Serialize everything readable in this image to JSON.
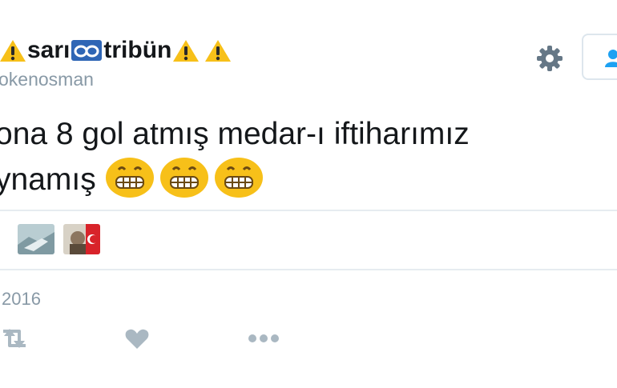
{
  "tweet": {
    "author": {
      "name_parts": [
        "sarı",
        "tribün"
      ],
      "username": "okenosman"
    },
    "text_lines": [
      "ona 8 gol atmış medar-ı iftiharımız",
      "ynamış"
    ],
    "date": "2016"
  },
  "icons": {
    "name_emojis": [
      "warning-sign",
      "loop",
      "warning-sign",
      "warning-sign"
    ],
    "text_emojis": [
      "grimacing-face",
      "grimacing-face",
      "grimacing-face"
    ],
    "header_actions": [
      "gear-icon",
      "follow-user-icon"
    ],
    "tweet_actions": [
      "retweet-icon",
      "like-icon",
      "more-icon"
    ]
  },
  "colors": {
    "emoji_yellow": "#f7c019",
    "muted_text": "#8899a6",
    "icon_gray": "#aab8c2",
    "accent": "#1da1f2",
    "divider": "#e6ecf0"
  }
}
